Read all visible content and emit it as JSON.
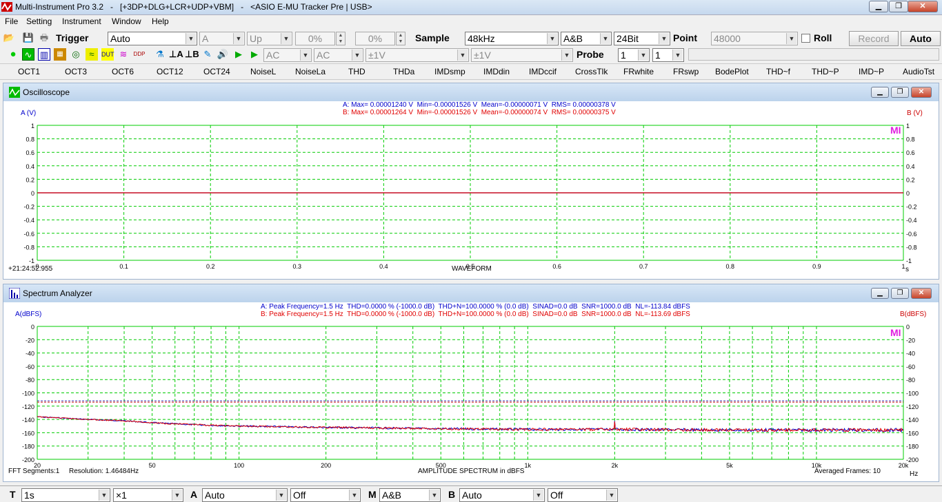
{
  "window": {
    "title": "Multi-Instrument Pro 3.2   -   [+3DP+DLG+LCR+UDP+VBM]   -   <ASIO E-MU Tracker Pre | USB>",
    "min": "▁",
    "max": "❐",
    "close": "✕"
  },
  "menu": [
    "File",
    "Setting",
    "Instrument",
    "Window",
    "Help"
  ],
  "toolbar1": {
    "trigger_label": "Trigger",
    "trigger_mode": "Auto",
    "trigger_channel": "A",
    "trigger_edge": "Up",
    "pct1": "0%",
    "pct2": "0%",
    "sample_label": "Sample",
    "sample_rate": "48kHz",
    "channels": "A&B",
    "bits": "24Bit",
    "point_label": "Point",
    "points": "48000",
    "roll_label": "Roll",
    "record_label": "Record",
    "auto_label": "Auto"
  },
  "toolbar2": {
    "coupling_a": "AC",
    "coupling_b": "AC",
    "range_a": "±1V",
    "range_b": "±1V",
    "probe_label": "Probe",
    "probe_a": "1",
    "probe_b": "1"
  },
  "toolbar3": [
    "OCT1",
    "OCT3",
    "OCT6",
    "OCT12",
    "OCT24",
    "NoiseL",
    "NoiseLa",
    "THD",
    "THDa",
    "IMDsmp",
    "IMDdin",
    "IMDccif",
    "CrossTlk",
    "FRwhite",
    "FRswp",
    "BodePlot",
    "THD~f",
    "THD~P",
    "IMD~P",
    "AudioTst"
  ],
  "scope": {
    "title": "Oscilloscope",
    "infoA": "A: Max= 0.00001240 V  Min=-0.00001526 V  Mean=-0.00000071 V  RMS= 0.00000378 V",
    "infoB": "B: Max= 0.00001264 V  Min=-0.00001526 V  Mean=-0.00000074 V  RMS= 0.00000375 V",
    "ylabelA": "A (V)",
    "ylabelB": "B (V)",
    "yticks": [
      "1",
      "0.8",
      "0.6",
      "0.4",
      "0.2",
      "0",
      "-0.2",
      "-0.4",
      "-0.6",
      "-0.8",
      "-1"
    ],
    "xticks": [
      "0",
      "0.1",
      "0.2",
      "0.3",
      "0.4",
      "0.5",
      "0.6",
      "0.7",
      "0.8",
      "0.9",
      "1"
    ],
    "xunit": "s",
    "xlabel": "WAVEFORM",
    "timestamp": "+21:24:52:955",
    "logo": "MI",
    "colors": {
      "grid": "#00cc00",
      "trace": "#e00000",
      "axis": "#00aa00"
    }
  },
  "spectrum": {
    "title": "Spectrum Analyzer",
    "infoA": "A: Peak Frequency=1.5 Hz  THD=0.0000 % (-1000.0 dB)  THD+N=100.0000 % (0.0 dB)  SINAD=0.0 dB  SNR=1000.0 dB  NL=-113.84 dBFS",
    "infoB": "B: Peak Frequency=1.5 Hz  THD=0.0000 % (-1000.0 dB)  THD+N=100.0000 % (0.0 dB)  SINAD=0.0 dB  SNR=1000.0 dB  NL=-113.69 dBFS",
    "ylabelA": "A(dBFS)",
    "ylabelB": "B(dBFS)",
    "yticksL": [
      "0",
      "-20",
      "-40",
      "-60",
      "-80",
      "-100",
      "-120",
      "-140",
      "-160",
      "-180",
      "-200"
    ],
    "yticksR": [
      "0",
      "-20",
      "-40",
      "-60",
      "-80",
      "-100",
      "-120",
      "-140",
      "-160",
      "-180",
      "-200"
    ],
    "xticks": [
      "20",
      "50",
      "100",
      "200",
      "500",
      "1k",
      "2k",
      "5k",
      "10k",
      "20k"
    ],
    "xunit": "Hz",
    "xlabel": "AMPLITUDE SPECTRUM in dBFS",
    "fft_segments": "FFT  Segments:1",
    "resolution": "Resolution:  1.46484Hz",
    "averaged": "Averaged Frames: 10",
    "logo": "MI",
    "noise_level_dbfs": -114
  },
  "chart_data": [
    {
      "type": "line",
      "title": "Oscilloscope",
      "xlabel": "WAVEFORM",
      "x_unit": "s",
      "ylabel": "A (V)",
      "ylabel_right": "B (V)",
      "xlim": [
        0,
        1
      ],
      "ylim": [
        -1,
        1
      ],
      "grid": true,
      "series": [
        {
          "name": "A",
          "x": [
            0,
            1
          ],
          "y": [
            0,
            0
          ]
        },
        {
          "name": "B",
          "x": [
            0,
            1
          ],
          "y": [
            0,
            0
          ]
        }
      ]
    },
    {
      "type": "line",
      "title": "Spectrum Analyzer",
      "xlabel": "AMPLITUDE SPECTRUM in dBFS",
      "x_unit": "Hz",
      "x_scale": "log",
      "ylabel": "A(dBFS)",
      "ylabel_right": "B(dBFS)",
      "xlim": [
        20,
        20000
      ],
      "ylim": [
        -200,
        0
      ],
      "grid": true,
      "series": [
        {
          "name": "A",
          "x": [
            20,
            30,
            40,
            50,
            70,
            100,
            200,
            500,
            1000,
            1990,
            2000,
            2010,
            5000,
            10000,
            20000
          ],
          "y": [
            -136,
            -140,
            -142,
            -145,
            -148,
            -150,
            -152,
            -154,
            -155,
            -155,
            -142,
            -155,
            -156,
            -156,
            -156
          ]
        },
        {
          "name": "B",
          "x": [
            20,
            30,
            40,
            50,
            70,
            100,
            200,
            500,
            1000,
            1990,
            2000,
            2010,
            5000,
            10000,
            20000
          ],
          "y": [
            -136,
            -140,
            -142,
            -145,
            -148,
            -150,
            -152,
            -154,
            -155,
            -155,
            -142,
            -155,
            -156,
            -156,
            -156
          ]
        }
      ]
    }
  ],
  "statusbar": {
    "t_label": "T",
    "t_value": "1s",
    "zoom": "×1",
    "a_label": "A",
    "a_value": "Auto",
    "a_extra": "Off",
    "m_label": "M",
    "m_value": "A&B",
    "b_label": "B",
    "b_value": "Auto",
    "b_extra": "Off"
  }
}
